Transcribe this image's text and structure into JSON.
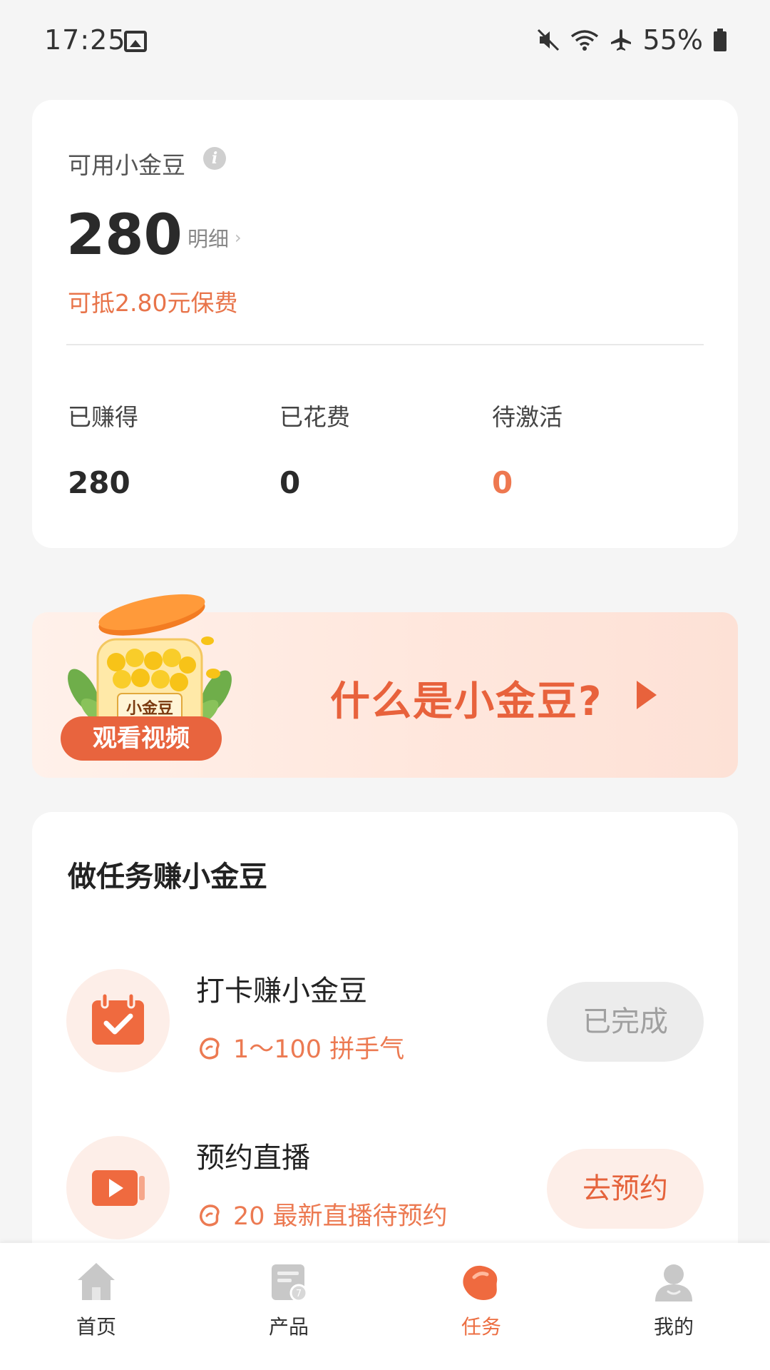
{
  "status_bar": {
    "time": "17:25",
    "battery": "55%",
    "icons": [
      "image-icon",
      "mute-icon",
      "wifi-icon",
      "airplane-icon",
      "battery-icon"
    ]
  },
  "balance": {
    "label": "可用小金豆",
    "value": "280",
    "detail_link": "明细",
    "worth": "可抵2.80元保费",
    "stats": [
      {
        "label": "已赚得",
        "value": "280"
      },
      {
        "label": "已花费",
        "value": "0"
      },
      {
        "label": "待激活",
        "value": "0"
      }
    ]
  },
  "banner": {
    "jar_label": "小金豆",
    "watch_button": "观看视频",
    "title": "什么是小金豆?"
  },
  "tasks": {
    "title": "做任务赚小金豆",
    "items": [
      {
        "title": "打卡赚小金豆",
        "reward": "1～100 拼手气",
        "button": "已完成",
        "icon": "calendar-check-icon"
      },
      {
        "title": "预约直播",
        "reward": "20 最新直播待预约",
        "button": "去预约",
        "icon": "video-play-icon"
      }
    ]
  },
  "nav": {
    "items": [
      {
        "label": "首页",
        "icon": "home-icon"
      },
      {
        "label": "产品",
        "icon": "product-icon"
      },
      {
        "label": "任务",
        "icon": "bean-icon"
      },
      {
        "label": "我的",
        "icon": "profile-icon"
      }
    ],
    "active_index": 2
  },
  "colors": {
    "accent": "#ec6e42",
    "accent_light": "#fdeee8",
    "done_button": "#ececec"
  }
}
